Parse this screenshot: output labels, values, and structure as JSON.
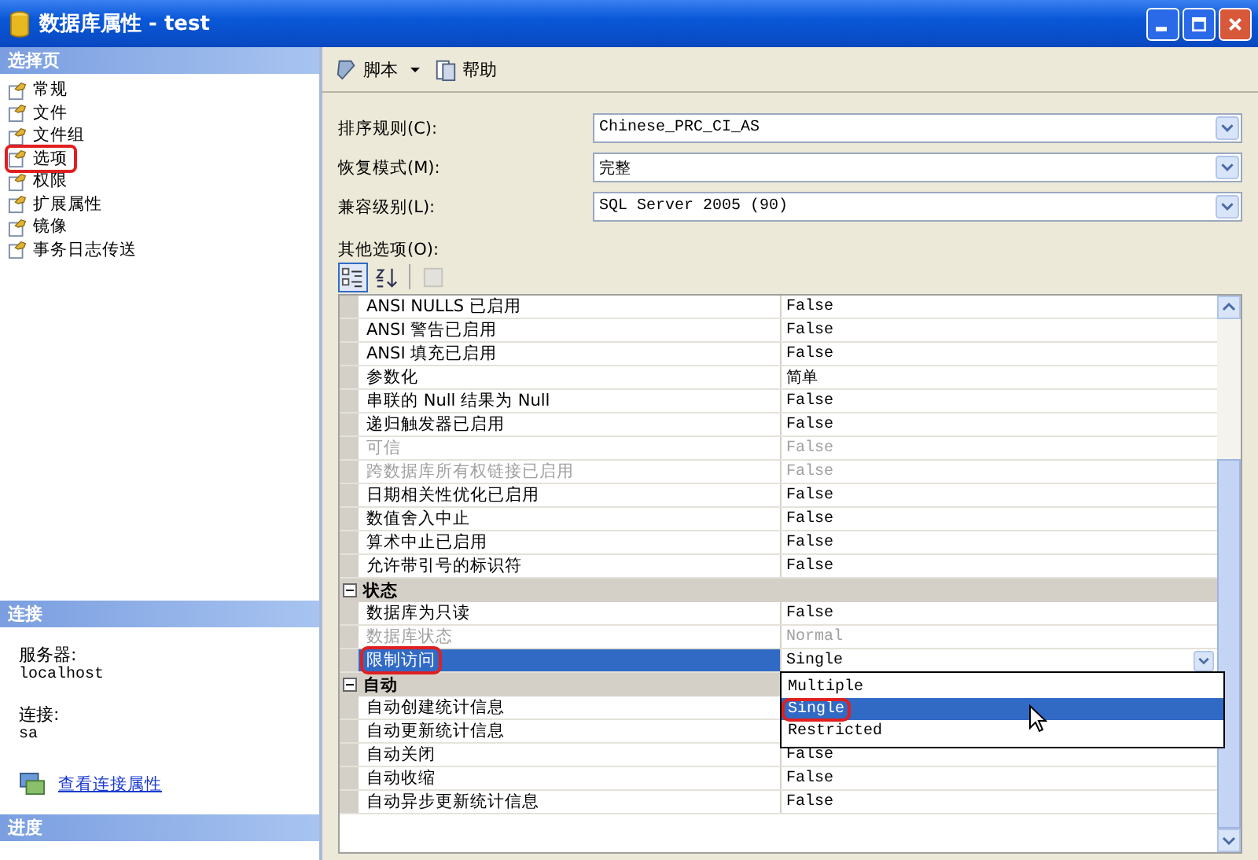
{
  "window": {
    "title": "数据库属性 - test"
  },
  "sidebar": {
    "header": "选择页",
    "items": [
      {
        "label": "常规",
        "annotated": false
      },
      {
        "label": "文件",
        "annotated": false
      },
      {
        "label": "文件组",
        "annotated": false
      },
      {
        "label": "选项",
        "annotated": true
      },
      {
        "label": "权限",
        "annotated": false
      },
      {
        "label": "扩展属性",
        "annotated": false
      },
      {
        "label": "镜像",
        "annotated": false
      },
      {
        "label": "事务日志传送",
        "annotated": false
      }
    ]
  },
  "connection": {
    "header": "连接",
    "server_label": "服务器:",
    "server": "localhost",
    "connection_label": "连接:",
    "connection": "sa",
    "link": "查看连接属性"
  },
  "progress": {
    "header": "进度"
  },
  "toolbar": {
    "buttons": [
      {
        "label": "脚本",
        "kind": "dropdown"
      },
      {
        "label": "帮助",
        "kind": "plain"
      }
    ]
  },
  "fields": [
    {
      "label": "排序规则(C):",
      "value": "Chinese_PRC_CI_AS"
    },
    {
      "label": "恢复模式(M):",
      "value": "完整"
    },
    {
      "label": "兼容级别(L):",
      "value": "SQL Server 2005 (90)"
    }
  ],
  "other_options": {
    "label": "其他选项(O):",
    "sections": [
      {
        "rows": [
          {
            "name": "ANSI NULLS 已启用",
            "value": "False",
            "disabled": false,
            "selected": false,
            "annotated": false
          },
          {
            "name": "ANSI 警告已启用",
            "value": "False",
            "disabled": false,
            "selected": false,
            "annotated": false
          },
          {
            "name": "ANSI 填充已启用",
            "value": "False",
            "disabled": false,
            "selected": false,
            "annotated": false
          },
          {
            "name": "参数化",
            "value": "简单",
            "disabled": false,
            "selected": false,
            "annotated": false
          },
          {
            "name": "串联的 Null 结果为 Null",
            "value": "False",
            "disabled": false,
            "selected": false,
            "annotated": false
          },
          {
            "name": "递归触发器已启用",
            "value": "False",
            "disabled": false,
            "selected": false,
            "annotated": false
          },
          {
            "name": "可信",
            "value": "False",
            "disabled": true,
            "selected": false,
            "annotated": false
          },
          {
            "name": "跨数据库所有权链接已启用",
            "value": "False",
            "disabled": true,
            "selected": false,
            "annotated": false
          },
          {
            "name": "日期相关性优化已启用",
            "value": "False",
            "disabled": false,
            "selected": false,
            "annotated": false
          },
          {
            "name": "数值舍入中止",
            "value": "False",
            "disabled": false,
            "selected": false,
            "annotated": false
          },
          {
            "name": "算术中止已启用",
            "value": "False",
            "disabled": false,
            "selected": false,
            "annotated": false
          },
          {
            "name": "允许带引号的标识符",
            "value": "False",
            "disabled": false,
            "selected": false,
            "annotated": false
          }
        ]
      },
      {
        "title": "状态",
        "expanded": true,
        "rows": [
          {
            "name": "数据库为只读",
            "value": "False",
            "disabled": false,
            "selected": false,
            "annotated": false
          },
          {
            "name": "数据库状态",
            "value": "Normal",
            "disabled": true,
            "selected": false,
            "annotated": false
          },
          {
            "name": "限制访问",
            "value": "Single",
            "disabled": false,
            "selected": true,
            "annotated": true,
            "dropdown": {
              "open": true,
              "options": [
                {
                  "label": "Multiple",
                  "selected": false,
                  "annotated": false
                },
                {
                  "label": "Single",
                  "selected": true,
                  "annotated": true
                },
                {
                  "label": "Restricted",
                  "selected": false,
                  "annotated": false
                }
              ]
            }
          }
        ]
      },
      {
        "title": "自动",
        "expanded": true,
        "rows": [
          {
            "name": "自动创建统计信息",
            "disabled": false,
            "selected": false,
            "annotated": false
          },
          {
            "name": "自动更新统计信息",
            "disabled": false,
            "selected": false,
            "annotated": false
          },
          {
            "name": "自动关闭",
            "value": "False",
            "disabled": false,
            "selected": false,
            "annotated": false
          },
          {
            "name": "自动收缩",
            "value": "False",
            "disabled": false,
            "selected": false,
            "annotated": false
          },
          {
            "name": "自动异步更新统计信息",
            "value": "False",
            "disabled": false,
            "selected": false,
            "annotated": false
          }
        ]
      }
    ]
  }
}
